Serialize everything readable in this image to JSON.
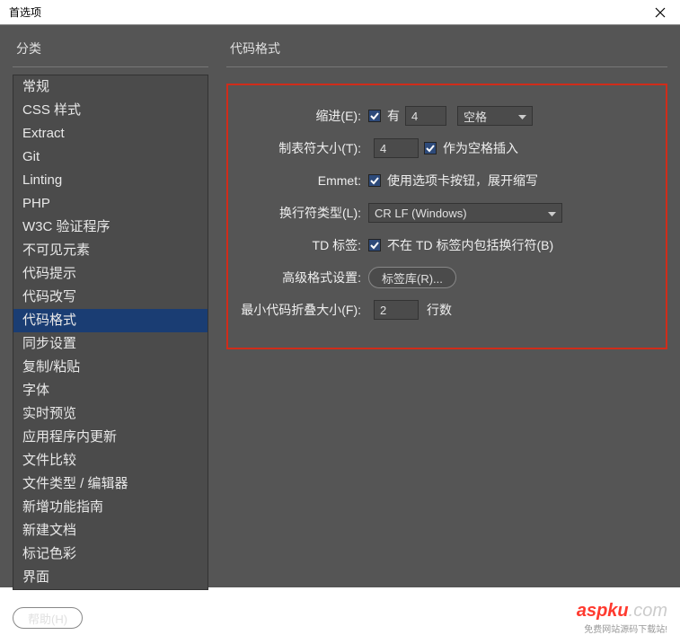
{
  "window": {
    "title": "首选项"
  },
  "sidebar": {
    "header": "分类",
    "items": [
      "常规",
      "CSS 样式",
      "Extract",
      "Git",
      "Linting",
      "PHP",
      "W3C 验证程序",
      "不可见元素",
      "代码提示",
      "代码改写",
      "代码格式",
      "同步设置",
      "复制/粘贴",
      "字体",
      "实时预览",
      "应用程序内更新",
      "文件比较",
      "文件类型 / 编辑器",
      "新增功能指南",
      "新建文档",
      "标记色彩",
      "界面"
    ],
    "selected_index": 10
  },
  "panel": {
    "header": "代码格式",
    "indent": {
      "label": "缩进(E):",
      "has_checked": true,
      "has_text": "有",
      "value": "4",
      "unit": "空格"
    },
    "tabsize": {
      "label": "制表符大小(T):",
      "value": "4",
      "as_spaces_checked": true,
      "as_spaces_text": "作为空格插入"
    },
    "emmet": {
      "label": "Emmet:",
      "checked": true,
      "text": "使用选项卡按钮，展开缩写"
    },
    "linebreak": {
      "label": "换行符类型(L):",
      "value": "CR LF (Windows)"
    },
    "tdtag": {
      "label": "TD 标签:",
      "checked": true,
      "text": "不在 TD 标签内包括换行符(B)"
    },
    "advanced": {
      "label": "高级格式设置:",
      "button": "标签库(R)..."
    },
    "minfold": {
      "label": "最小代码折叠大小(F):",
      "value": "2",
      "suffix": "行数"
    }
  },
  "footer": {
    "help": "帮助(H)"
  },
  "watermark": {
    "brand_a": "aspku",
    "brand_b": ".com",
    "tagline": "免费网站源码下载站!"
  }
}
